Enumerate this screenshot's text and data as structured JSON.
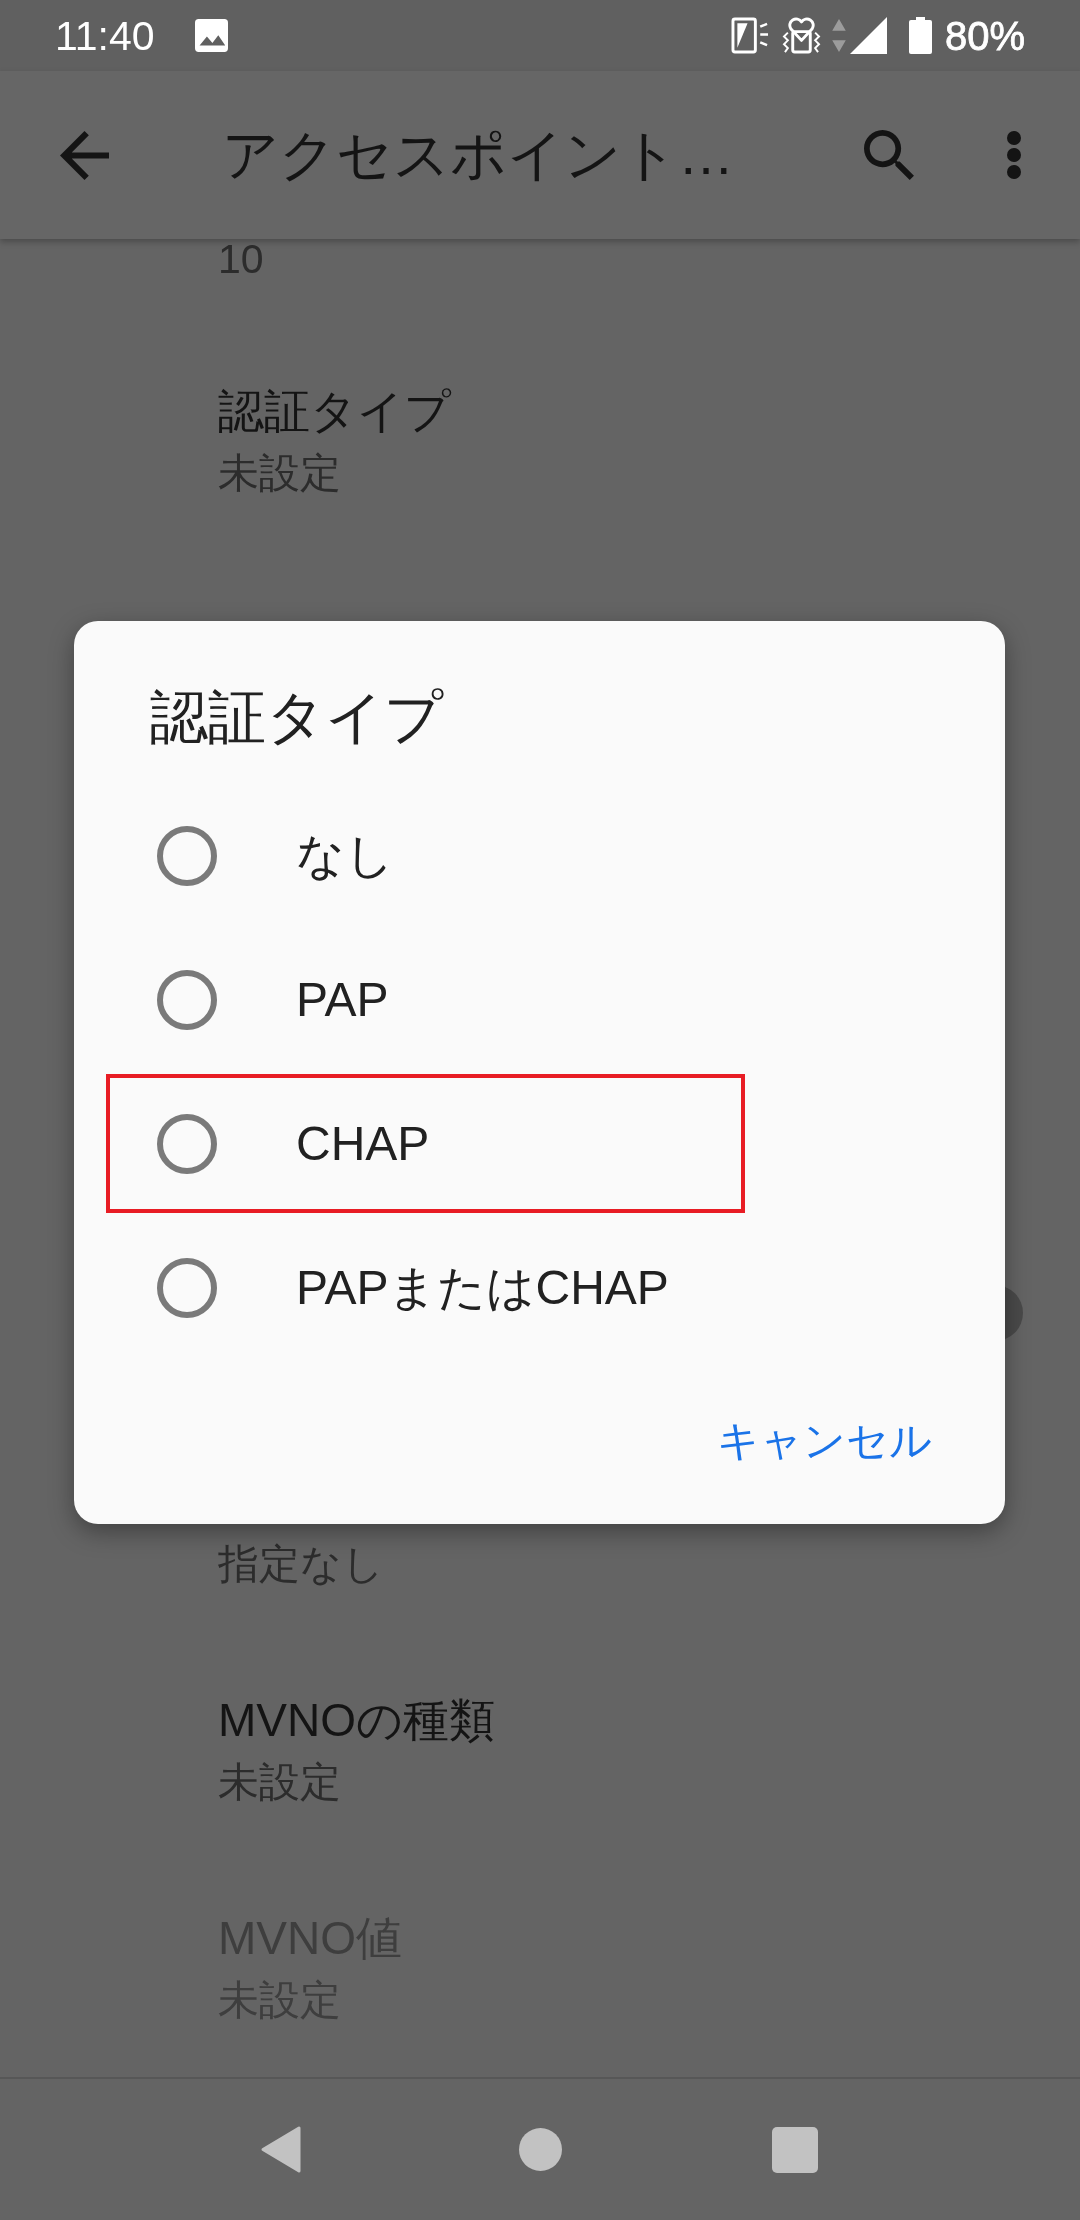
{
  "status_bar": {
    "time": "11:40",
    "battery": "80%"
  },
  "app_bar": {
    "title": "アクセスポイント…"
  },
  "settings_above": [
    {
      "summary": "10",
      "disabled": false
    },
    {
      "title": "認証タイプ",
      "summary": "未設定",
      "disabled": false
    }
  ],
  "settings_below": [
    {
      "summary": "指定なし",
      "disabled": false
    },
    {
      "title": "MVNOの種類",
      "summary": "未設定",
      "disabled": false
    },
    {
      "title": "MVNO値",
      "summary": "未設定",
      "disabled": true
    }
  ],
  "dialog": {
    "title": "認証タイプ",
    "options": [
      {
        "label": "なし",
        "selected": false,
        "highlighted": false
      },
      {
        "label": "PAP",
        "selected": false,
        "highlighted": false
      },
      {
        "label": "CHAP",
        "selected": false,
        "highlighted": true
      },
      {
        "label": "PAPまたはCHAP",
        "selected": false,
        "highlighted": false
      }
    ],
    "buttons": [
      "キャンセル"
    ]
  }
}
